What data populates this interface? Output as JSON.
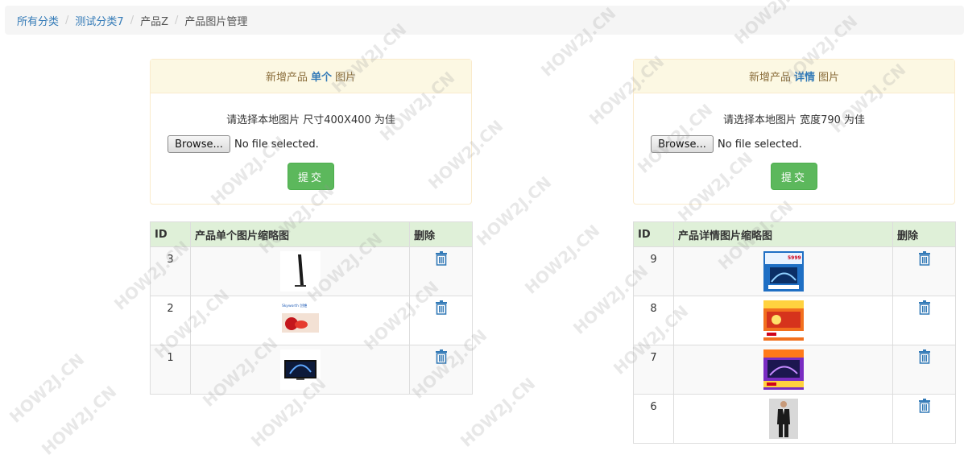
{
  "breadcrumb": {
    "items": [
      "所有分类",
      "测试分类7",
      "产品Z",
      "产品图片管理"
    ],
    "separator": "/"
  },
  "single_panel": {
    "heading_prefix": "新增产品",
    "heading_emphasis": "单个",
    "heading_suffix": "图片",
    "hint": "请选择本地图片 尺寸400X400 为佳",
    "browse_label": "Browse...",
    "file_status": "No file selected.",
    "submit_label": "提交"
  },
  "detail_panel": {
    "heading_prefix": "新增产品",
    "heading_emphasis": "详情",
    "heading_suffix": "图片",
    "hint": "请选择本地图片 宽度790 为佳",
    "browse_label": "Browse...",
    "file_status": "No file selected.",
    "submit_label": "提交"
  },
  "single_table": {
    "headers": [
      "ID",
      "产品单个图片缩略图",
      "删除"
    ],
    "rows": [
      {
        "id": "3",
        "thumb": "tv-stand-thumb"
      },
      {
        "id": "2",
        "thumb": "skyworth-banner-thumb"
      },
      {
        "id": "1",
        "thumb": "tv-front-thumb"
      }
    ]
  },
  "detail_table": {
    "headers": [
      "ID",
      "产品详情图片缩略图",
      "删除"
    ],
    "rows": [
      {
        "id": "9",
        "thumb": "blue-promo-thumb"
      },
      {
        "id": "8",
        "thumb": "orange-promo-thumb"
      },
      {
        "id": "7",
        "thumb": "purple-promo-thumb"
      },
      {
        "id": "6",
        "thumb": "suit-man-thumb"
      }
    ]
  },
  "thumb_texts": {
    "skyworth": "Skyworth 创维",
    "price": "5999"
  },
  "watermark_text": "HOW2J.CN",
  "colors": {
    "link": "#337ab7",
    "panel_warning_bg": "#fcf8e3",
    "table_header_bg": "#dff0d8",
    "submit_bg": "#5cb85c"
  }
}
